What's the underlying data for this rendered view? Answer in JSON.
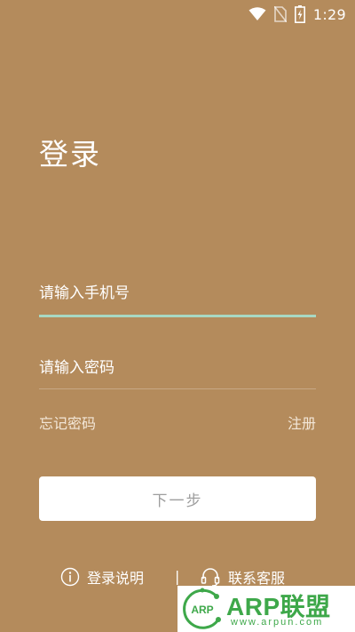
{
  "status_bar": {
    "time": "1:29",
    "icons": [
      "wifi-icon",
      "no-sim-icon",
      "battery-charging-icon"
    ]
  },
  "login": {
    "title": "登录",
    "phone_placeholder": "请输入手机号",
    "password_placeholder": "请输入密码",
    "forgot_password": "忘记密码",
    "register": "注册",
    "next_button": "下一步"
  },
  "footer": {
    "help_label": "登录说明",
    "divider": "|",
    "service_label": "联系客服",
    "icons": [
      "info-icon",
      "headset-icon"
    ]
  },
  "watermark": {
    "main_text": "ARP联盟",
    "sub_text": "www.arpun.com",
    "badge_text": "ARP"
  },
  "colors": {
    "background": "#b48b5c",
    "active_underline": "#a8d8c2",
    "watermark_green": "#3ea84a"
  }
}
